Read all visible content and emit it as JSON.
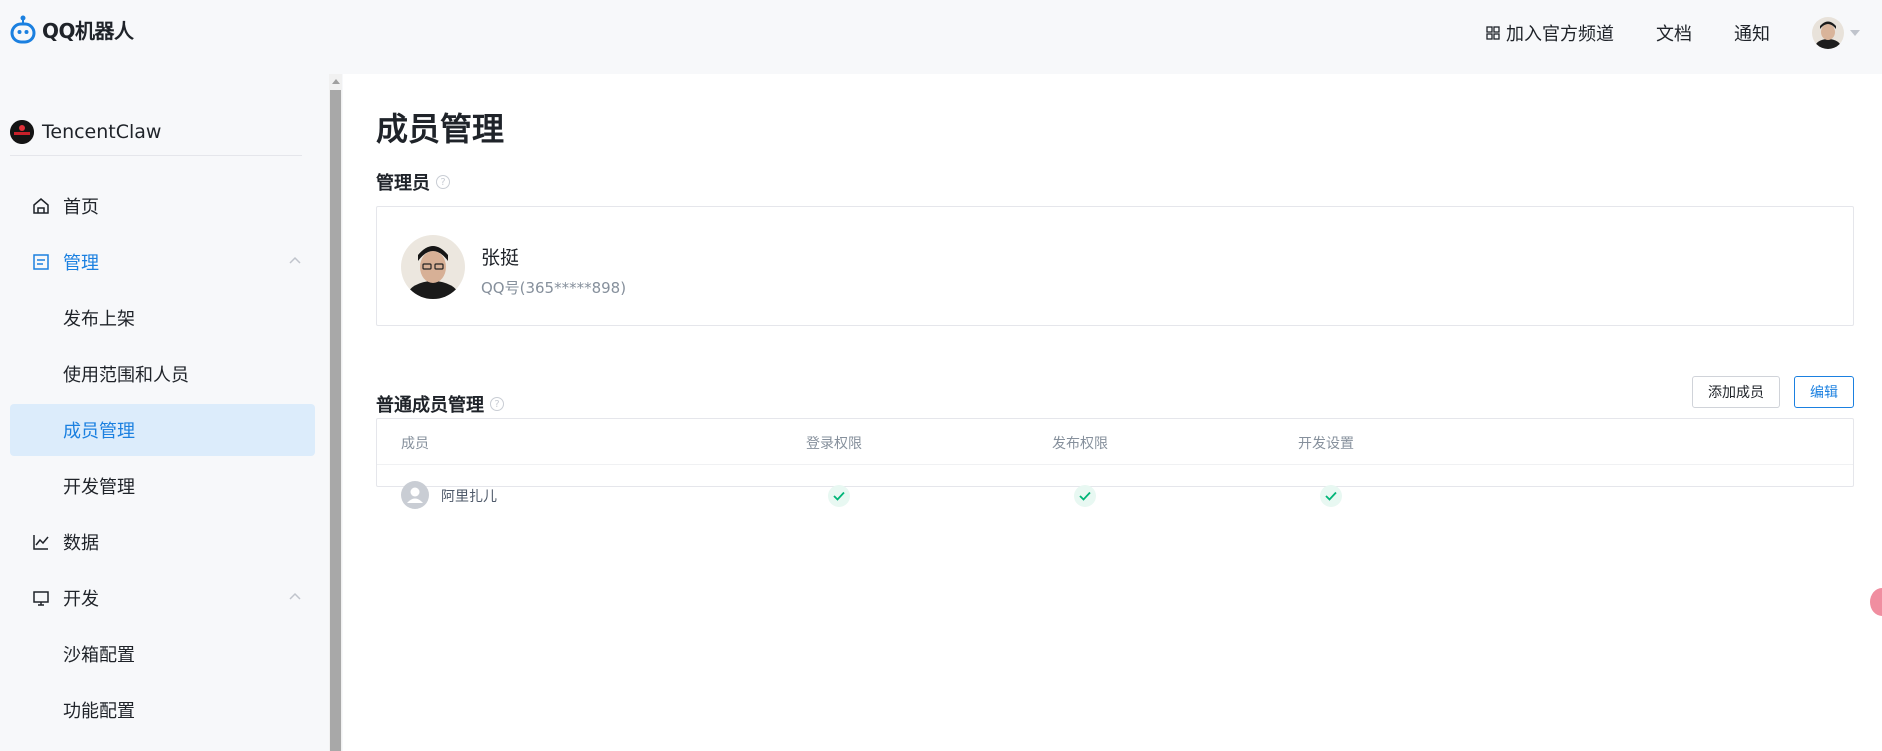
{
  "header": {
    "logo_text": "QQ机器人",
    "nav": [
      {
        "label": "加入官方频道",
        "icon": "grid-icon"
      },
      {
        "label": "文档"
      },
      {
        "label": "通知"
      }
    ]
  },
  "sidebar": {
    "project_name": "TencentClaw",
    "items": [
      {
        "label": "首页",
        "icon": "home-icon"
      },
      {
        "label": "管理",
        "icon": "manage-icon"
      },
      {
        "label": "发布上架"
      },
      {
        "label": "使用范围和人员"
      },
      {
        "label": "成员管理"
      },
      {
        "label": "开发管理"
      },
      {
        "label": "数据",
        "icon": "chart-icon"
      },
      {
        "label": "开发",
        "icon": "monitor-icon"
      },
      {
        "label": "沙箱配置"
      },
      {
        "label": "功能配置"
      }
    ]
  },
  "main": {
    "title": "成员管理",
    "admin_section_title": "管理员",
    "admin": {
      "name": "张挺",
      "qq": "QQ号(365*****898)"
    },
    "members_section_title": "普通成员管理",
    "add_member_label": "添加成员",
    "edit_label": "编辑",
    "table": {
      "columns": [
        "成员",
        "登录权限",
        "发布权限",
        "开发设置"
      ],
      "rows": [
        {
          "name": "阿里扎儿",
          "login": true,
          "publish": true,
          "dev": true
        }
      ]
    },
    "help_glyph": "?"
  },
  "colors": {
    "accent": "#1b80e0",
    "active_bg": "#dcecfb",
    "check": "#00b578"
  }
}
